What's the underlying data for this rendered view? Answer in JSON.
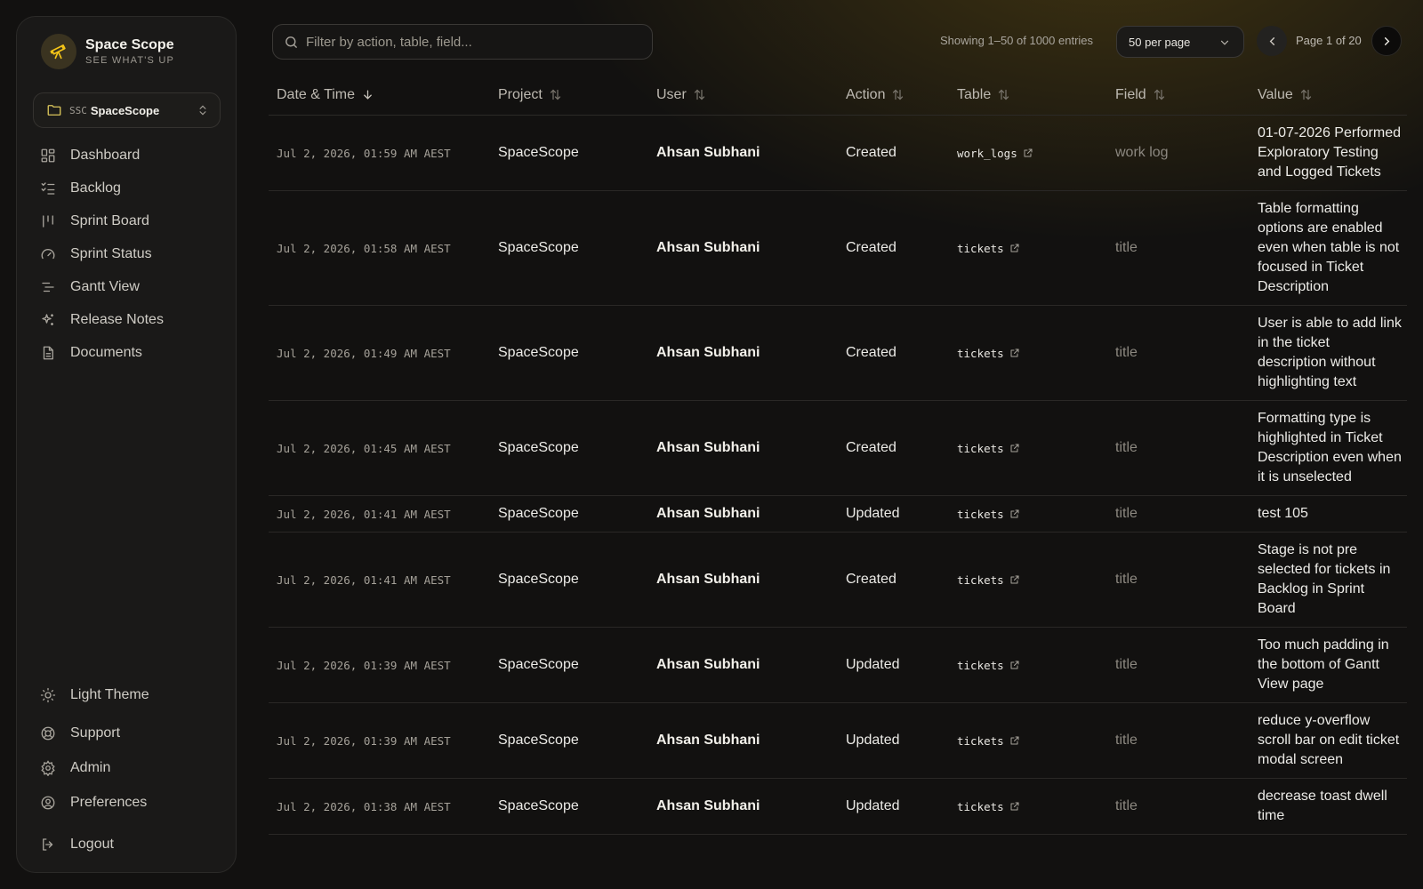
{
  "brand": {
    "name": "Space Scope",
    "tagline": "SEE WHAT'S UP"
  },
  "project": {
    "code": "SSC",
    "name": "SpaceScope"
  },
  "nav": [
    {
      "label": "Dashboard",
      "icon": "dashboard-icon"
    },
    {
      "label": "Backlog",
      "icon": "list-checks-icon"
    },
    {
      "label": "Sprint Board",
      "icon": "kanban-icon"
    },
    {
      "label": "Sprint Status",
      "icon": "gauge-icon"
    },
    {
      "label": "Gantt View",
      "icon": "gantt-icon"
    },
    {
      "label": "Release Notes",
      "icon": "sparkles-icon"
    },
    {
      "label": "Documents",
      "icon": "document-icon"
    }
  ],
  "nav_bottom": [
    {
      "label": "Light Theme",
      "icon": "sun-icon"
    },
    {
      "label": "Support",
      "icon": "lifebuoy-icon"
    },
    {
      "label": "Admin",
      "icon": "gear-icon"
    },
    {
      "label": "Preferences",
      "icon": "user-circle-icon"
    },
    {
      "label": "Logout",
      "icon": "logout-icon"
    }
  ],
  "search": {
    "placeholder": "Filter by action, table, field..."
  },
  "pagination": {
    "entries_text": "Showing 1–50 of 1000 entries",
    "per_page": "50 per page",
    "page_text": "Page 1 of 20"
  },
  "table": {
    "columns": [
      "Date & Time",
      "Project",
      "User",
      "Action",
      "Table",
      "Field",
      "Value"
    ],
    "rows": [
      {
        "datetime": "Jul 2, 2026, 01:59 AM AEST",
        "project": "SpaceScope",
        "user": "Ahsan Subhani",
        "action": "Created",
        "table": "work_logs",
        "field": "work log",
        "value": "01-07-2026 Performed Exploratory Testing and Logged Tickets"
      },
      {
        "datetime": "Jul 2, 2026, 01:58 AM AEST",
        "project": "SpaceScope",
        "user": "Ahsan Subhani",
        "action": "Created",
        "table": "tickets",
        "field": "title",
        "value": "Table formatting options are enabled even when table is not focused in Ticket Description"
      },
      {
        "datetime": "Jul 2, 2026, 01:49 AM AEST",
        "project": "SpaceScope",
        "user": "Ahsan Subhani",
        "action": "Created",
        "table": "tickets",
        "field": "title",
        "value": "User is able to add link in the ticket description without highlighting text"
      },
      {
        "datetime": "Jul 2, 2026, 01:45 AM AEST",
        "project": "SpaceScope",
        "user": "Ahsan Subhani",
        "action": "Created",
        "table": "tickets",
        "field": "title",
        "value": "Formatting type is highlighted in Ticket Description even when it is unselected"
      },
      {
        "datetime": "Jul 2, 2026, 01:41 AM AEST",
        "project": "SpaceScope",
        "user": "Ahsan Subhani",
        "action": "Updated",
        "table": "tickets",
        "field": "title",
        "value": "test 105"
      },
      {
        "datetime": "Jul 2, 2026, 01:41 AM AEST",
        "project": "SpaceScope",
        "user": "Ahsan Subhani",
        "action": "Created",
        "table": "tickets",
        "field": "title",
        "value": "Stage is not pre selected for tickets in Backlog in Sprint Board"
      },
      {
        "datetime": "Jul 2, 2026, 01:39 AM AEST",
        "project": "SpaceScope",
        "user": "Ahsan Subhani",
        "action": "Updated",
        "table": "tickets",
        "field": "title",
        "value": "Too much padding in the bottom of Gantt View page"
      },
      {
        "datetime": "Jul 2, 2026, 01:39 AM AEST",
        "project": "SpaceScope",
        "user": "Ahsan Subhani",
        "action": "Updated",
        "table": "tickets",
        "field": "title",
        "value": "reduce y-overflow scroll bar on edit ticket modal screen"
      },
      {
        "datetime": "Jul 2, 2026, 01:38 AM AEST",
        "project": "SpaceScope",
        "user": "Ahsan Subhani",
        "action": "Updated",
        "table": "tickets",
        "field": "title",
        "value": "decrease toast dwell time"
      }
    ]
  },
  "colors": {
    "accent": "#f5c518",
    "background": "#121110",
    "sidebar": "#1a1918"
  }
}
